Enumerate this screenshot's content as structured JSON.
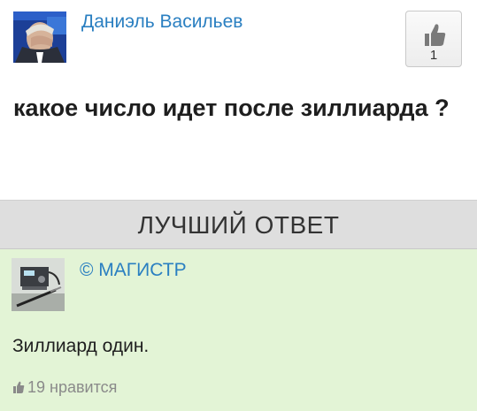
{
  "question": {
    "author_name": "Даниэль Васильев",
    "like_count": "1",
    "text": "какое число идет после зиллиарда ?"
  },
  "best_answer": {
    "header": "ЛУЧШИЙ ОТВЕТ",
    "author_name": "© МАГИСТР",
    "text": "Зиллиард один.",
    "likes_label": "19 нравится"
  },
  "icons": {
    "question_like": "thumbs-up-icon",
    "answer_likes": "thumbs-up-icon"
  },
  "colors": {
    "link": "#2a7fc1",
    "answer_background": "#e3f4d6",
    "header_background": "#dedede"
  }
}
